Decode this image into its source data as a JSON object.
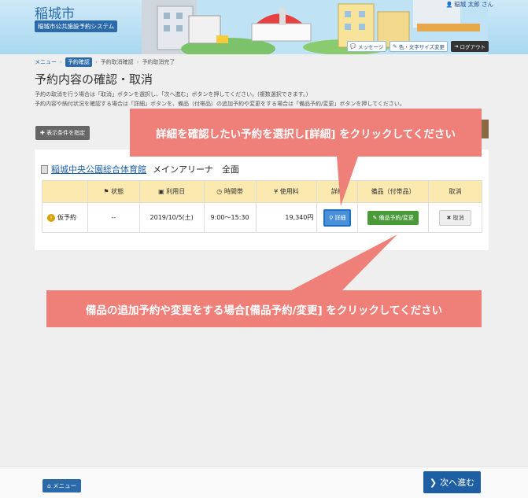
{
  "header": {
    "city_name": "稲城市",
    "system_name": "稲城市公共施設予約システム",
    "user_name": "稲城 太郎 さん",
    "message_label": "メッセージ",
    "color_size_label": "色・文字サイズ変更",
    "logout_label": "ログアウト"
  },
  "breadcrumb": {
    "items": [
      "メニュー",
      "予約確認",
      "予約取消確認",
      "予約取消完了"
    ],
    "separator": "›"
  },
  "page": {
    "title": "予約内容の確認・取消",
    "desc1": "予約の取消を行う場合は「取消」ボタンを選択し、「次へ進む」ボタンを押してください。(複数選択できます。)",
    "desc2": "予約内容や納付状況を確認する場合は「詳細」ボタンを、備品（付帯品）の追加予約や変更をする場合は「備品予約/変更」ボタンを押してください。",
    "condition_button": "表示条件を指定"
  },
  "facility": {
    "name": "稲城中央公園総合体育館",
    "room": "メインアリーナ　全面"
  },
  "table": {
    "headers": [
      "状態",
      "利用日",
      "時間帯",
      "使用料",
      "詳細",
      "備品（付帯品）",
      "取消"
    ],
    "row": {
      "status": "仮予約",
      "dash": "--",
      "date": "2019/10/5(土)",
      "time": "9:00～15:30",
      "fee": "19,340円",
      "detail_button": "詳細",
      "equip_button": "備品予約/変更",
      "cancel_button": "取消"
    }
  },
  "callouts": {
    "detail": "詳細を確認したい予約を選択し[詳細] をクリックしてください",
    "equipment": "備品の追加予約や変更をする場合[備品予約/変更] をクリックしてください"
  },
  "footer": {
    "menu_button": "メニュー",
    "next_button": "次へ進む"
  },
  "colors": {
    "accent": "#2a6aa8",
    "callout": "#ef8079",
    "table_header": "#fbe9b0"
  }
}
